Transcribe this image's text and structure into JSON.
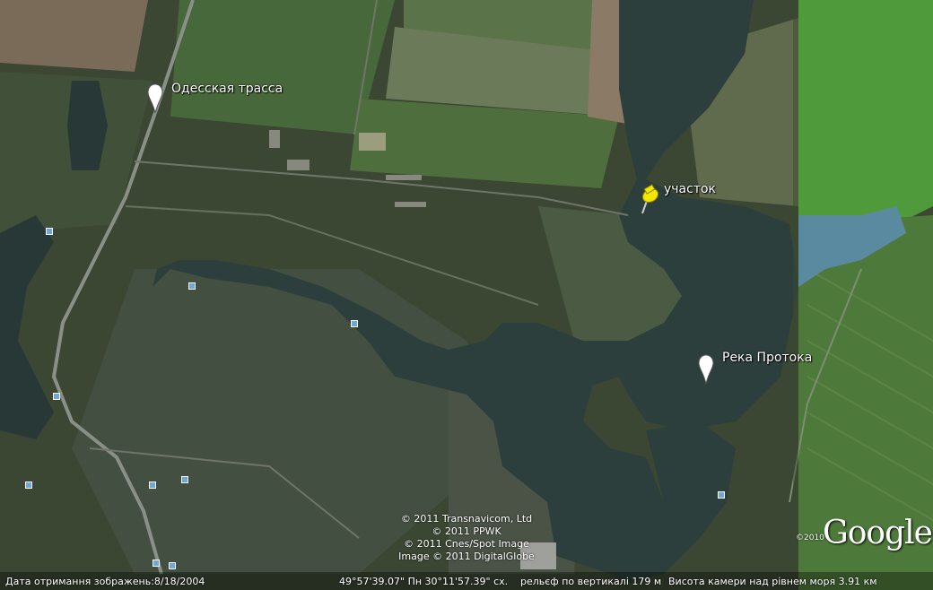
{
  "map": {
    "labels": {
      "odessa_highway": "Одесская трасса",
      "plot": "участок",
      "river": "Река Протока"
    },
    "attribution": {
      "line1": "© 2011 Transnavicom, Ltd",
      "line2": "© 2011 PPWK",
      "line3": "© 2011 Cnes/Spot Image",
      "line4": "Image © 2011 DigitalGlobe"
    },
    "logo": {
      "year": "©2010",
      "text": "Google"
    },
    "status_bar": {
      "image_date": "Дата отримання зображень:8/18/2004",
      "coordinates": "49°57'39.07\" Пн  30°11'57.39\" сх.",
      "elevation": "рельєф по вертикалі  179 м",
      "eye_altitude": "Висота камери над рівнем моря    3.91 км"
    },
    "colors": {
      "water": "#2c3f3d",
      "fields": "#4f6b3c",
      "bright_field": "#4f9a3a",
      "pin_white": "#ffffff",
      "pin_yellow": "#f5e600",
      "poi": "#6ea8d8"
    },
    "icons": [
      "placemark-white-icon",
      "pushpin-yellow-icon",
      "poi-square-icon"
    ]
  }
}
